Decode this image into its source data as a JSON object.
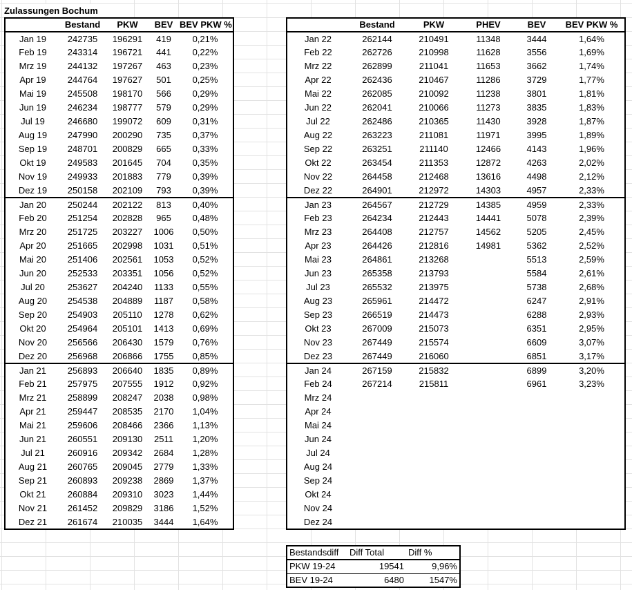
{
  "title": "Zulassungen Bochum",
  "table1": {
    "headers": [
      "",
      "Bestand",
      "PKW",
      "BEV",
      "BEV PKW %"
    ],
    "rows": [
      [
        "Jan 19",
        "242735",
        "196291",
        "419",
        "0,21%"
      ],
      [
        "Feb 19",
        "243314",
        "196721",
        "441",
        "0,22%"
      ],
      [
        "Mrz 19",
        "244132",
        "197267",
        "463",
        "0,23%"
      ],
      [
        "Apr 19",
        "244764",
        "197627",
        "501",
        "0,25%"
      ],
      [
        "Mai 19",
        "245508",
        "198170",
        "566",
        "0,29%"
      ],
      [
        "Jun 19",
        "246234",
        "198777",
        "579",
        "0,29%"
      ],
      [
        "Jul 19",
        "246680",
        "199072",
        "609",
        "0,31%"
      ],
      [
        "Aug 19",
        "247990",
        "200290",
        "735",
        "0,37%"
      ],
      [
        "Sep 19",
        "248701",
        "200829",
        "665",
        "0,33%"
      ],
      [
        "Okt 19",
        "249583",
        "201645",
        "704",
        "0,35%"
      ],
      [
        "Nov 19",
        "249933",
        "201883",
        "779",
        "0,39%"
      ],
      [
        "Dez 19",
        "250158",
        "202109",
        "793",
        "0,39%"
      ],
      [
        "Jan 20",
        "250244",
        "202122",
        "813",
        "0,40%"
      ],
      [
        "Feb 20",
        "251254",
        "202828",
        "965",
        "0,48%"
      ],
      [
        "Mrz 20",
        "251725",
        "203227",
        "1006",
        "0,50%"
      ],
      [
        "Apr 20",
        "251665",
        "202998",
        "1031",
        "0,51%"
      ],
      [
        "Mai 20",
        "251406",
        "202561",
        "1053",
        "0,52%"
      ],
      [
        "Jun 20",
        "252533",
        "203351",
        "1056",
        "0,52%"
      ],
      [
        "Jul 20",
        "253627",
        "204240",
        "1133",
        "0,55%"
      ],
      [
        "Aug 20",
        "254538",
        "204889",
        "1187",
        "0,58%"
      ],
      [
        "Sep 20",
        "254903",
        "205110",
        "1278",
        "0,62%"
      ],
      [
        "Okt 20",
        "254964",
        "205101",
        "1413",
        "0,69%"
      ],
      [
        "Nov 20",
        "256566",
        "206430",
        "1579",
        "0,76%"
      ],
      [
        "Dez 20",
        "256968",
        "206866",
        "1755",
        "0,85%"
      ],
      [
        "Jan 21",
        "256893",
        "206640",
        "1835",
        "0,89%"
      ],
      [
        "Feb 21",
        "257975",
        "207555",
        "1912",
        "0,92%"
      ],
      [
        "Mrz 21",
        "258899",
        "208247",
        "2038",
        "0,98%"
      ],
      [
        "Apr 21",
        "259447",
        "208535",
        "2170",
        "1,04%"
      ],
      [
        "Mai 21",
        "259606",
        "208466",
        "2366",
        "1,13%"
      ],
      [
        "Jun 21",
        "260551",
        "209130",
        "2511",
        "1,20%"
      ],
      [
        "Jul 21",
        "260916",
        "209342",
        "2684",
        "1,28%"
      ],
      [
        "Aug 21",
        "260765",
        "209045",
        "2779",
        "1,33%"
      ],
      [
        "Sep 21",
        "260893",
        "209238",
        "2869",
        "1,37%"
      ],
      [
        "Okt 21",
        "260884",
        "209310",
        "3023",
        "1,44%"
      ],
      [
        "Nov 21",
        "261452",
        "209829",
        "3186",
        "1,52%"
      ],
      [
        "Dez 21",
        "261674",
        "210035",
        "3444",
        "1,64%"
      ]
    ]
  },
  "table2": {
    "headers": [
      "",
      "Bestand",
      "PKW",
      "PHEV",
      "BEV",
      "BEV PKW %"
    ],
    "rows": [
      [
        "Jan 22",
        "262144",
        "210491",
        "11348",
        "3444",
        "1,64%"
      ],
      [
        "Feb 22",
        "262726",
        "210998",
        "11628",
        "3556",
        "1,69%"
      ],
      [
        "Mrz 22",
        "262899",
        "211041",
        "11653",
        "3662",
        "1,74%"
      ],
      [
        "Apr 22",
        "262436",
        "210467",
        "11286",
        "3729",
        "1,77%"
      ],
      [
        "Mai 22",
        "262085",
        "210092",
        "11238",
        "3801",
        "1,81%"
      ],
      [
        "Jun 22",
        "262041",
        "210066",
        "11273",
        "3835",
        "1,83%"
      ],
      [
        "Jul 22",
        "262486",
        "210365",
        "11430",
        "3928",
        "1,87%"
      ],
      [
        "Aug 22",
        "263223",
        "211081",
        "11971",
        "3995",
        "1,89%"
      ],
      [
        "Sep 22",
        "263251",
        "211140",
        "12466",
        "4143",
        "1,96%"
      ],
      [
        "Okt 22",
        "263454",
        "211353",
        "12872",
        "4263",
        "2,02%"
      ],
      [
        "Nov 22",
        "264458",
        "212468",
        "13616",
        "4498",
        "2,12%"
      ],
      [
        "Dez 22",
        "264901",
        "212972",
        "14303",
        "4957",
        "2,33%"
      ],
      [
        "Jan 23",
        "264567",
        "212729",
        "14385",
        "4959",
        "2,33%"
      ],
      [
        "Feb 23",
        "264234",
        "212443",
        "14441",
        "5078",
        "2,39%"
      ],
      [
        "Mrz 23",
        "264408",
        "212757",
        "14562",
        "5205",
        "2,45%"
      ],
      [
        "Apr 23",
        "264426",
        "212816",
        "14981",
        "5362",
        "2,52%"
      ],
      [
        "Mai 23",
        "264861",
        "213268",
        "",
        "5513",
        "2,59%"
      ],
      [
        "Jun 23",
        "265358",
        "213793",
        "",
        "5584",
        "2,61%"
      ],
      [
        "Jul 23",
        "265532",
        "213975",
        "",
        "5738",
        "2,68%"
      ],
      [
        "Aug 23",
        "265961",
        "214472",
        "",
        "6247",
        "2,91%"
      ],
      [
        "Sep 23",
        "266519",
        "214473",
        "",
        "6288",
        "2,93%"
      ],
      [
        "Okt 23",
        "267009",
        "215073",
        "",
        "6351",
        "2,95%"
      ],
      [
        "Nov 23",
        "267449",
        "215574",
        "",
        "6609",
        "3,07%"
      ],
      [
        "Dez 23",
        "267449",
        "216060",
        "",
        "6851",
        "3,17%"
      ],
      [
        "Jan 24",
        "267159",
        "215832",
        "",
        "6899",
        "3,20%"
      ],
      [
        "Feb 24",
        "267214",
        "215811",
        "",
        "6961",
        "3,23%"
      ],
      [
        "Mrz 24",
        "",
        "",
        "",
        "",
        ""
      ],
      [
        "Apr 24",
        "",
        "",
        "",
        "",
        ""
      ],
      [
        "Mai 24",
        "",
        "",
        "",
        "",
        ""
      ],
      [
        "Jun 24",
        "",
        "",
        "",
        "",
        ""
      ],
      [
        "Jul 24",
        "",
        "",
        "",
        "",
        ""
      ],
      [
        "Aug 24",
        "",
        "",
        "",
        "",
        ""
      ],
      [
        "Sep 24",
        "",
        "",
        "",
        "",
        ""
      ],
      [
        "Okt 24",
        "",
        "",
        "",
        "",
        ""
      ],
      [
        "Nov 24",
        "",
        "",
        "",
        "",
        ""
      ],
      [
        "Dez 24",
        "",
        "",
        "",
        "",
        ""
      ]
    ]
  },
  "summary": {
    "headers": [
      "Bestandsdiff",
      "Diff Total",
      "Diff %"
    ],
    "rows": [
      [
        "PKW 19-24",
        "19541",
        "9,96%"
      ],
      [
        "BEV 19-24",
        "6480",
        "1547%"
      ]
    ]
  }
}
